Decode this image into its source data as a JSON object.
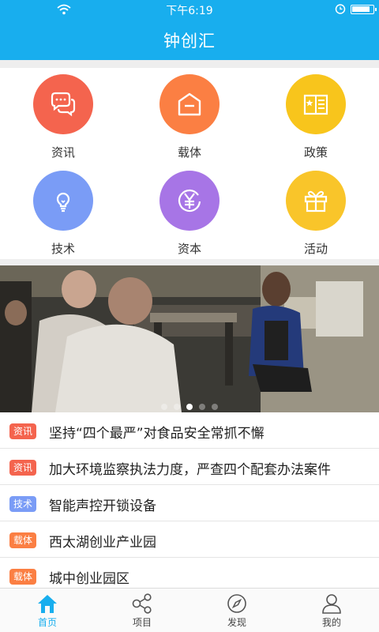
{
  "status_bar": {
    "time": "下午6:19"
  },
  "header": {
    "title": "钟创汇"
  },
  "categories": [
    {
      "label": "资讯",
      "color": "#f4644e",
      "icon": "chat-bubbles-icon"
    },
    {
      "label": "载体",
      "color": "#fb7f43",
      "icon": "building-icon"
    },
    {
      "label": "政策",
      "color": "#f8c51c",
      "icon": "policy-book-icon"
    },
    {
      "label": "技术",
      "color": "#7a9cf6",
      "icon": "lightbulb-icon"
    },
    {
      "label": "资本",
      "color": "#a775e6",
      "icon": "yuan-icon"
    },
    {
      "label": "活动",
      "color": "#f9c52a",
      "icon": "gift-icon"
    }
  ],
  "banner": {
    "slide_count": 5,
    "active_slide": 2
  },
  "news": [
    {
      "tag": "资讯",
      "tag_color": "#f4644e",
      "title": "坚持“四个最严”对食品安全常抓不懈"
    },
    {
      "tag": "资讯",
      "tag_color": "#f4644e",
      "title": "加大环境监察执法力度，严查四个配套办法案件"
    },
    {
      "tag": "技术",
      "tag_color": "#7a9cf6",
      "title": "智能声控开锁设备"
    },
    {
      "tag": "载体",
      "tag_color": "#fb7f43",
      "title": "西太湖创业产业园"
    },
    {
      "tag": "载体",
      "tag_color": "#fb7f43",
      "title": "城中创业园区"
    }
  ],
  "tabs": [
    {
      "label": "首页",
      "icon": "home-icon",
      "active": true
    },
    {
      "label": "项目",
      "icon": "share-nodes-icon",
      "active": false
    },
    {
      "label": "发现",
      "icon": "compass-icon",
      "active": false
    },
    {
      "label": "我的",
      "icon": "user-icon",
      "active": false
    }
  ],
  "colors": {
    "primary": "#18aeee"
  }
}
